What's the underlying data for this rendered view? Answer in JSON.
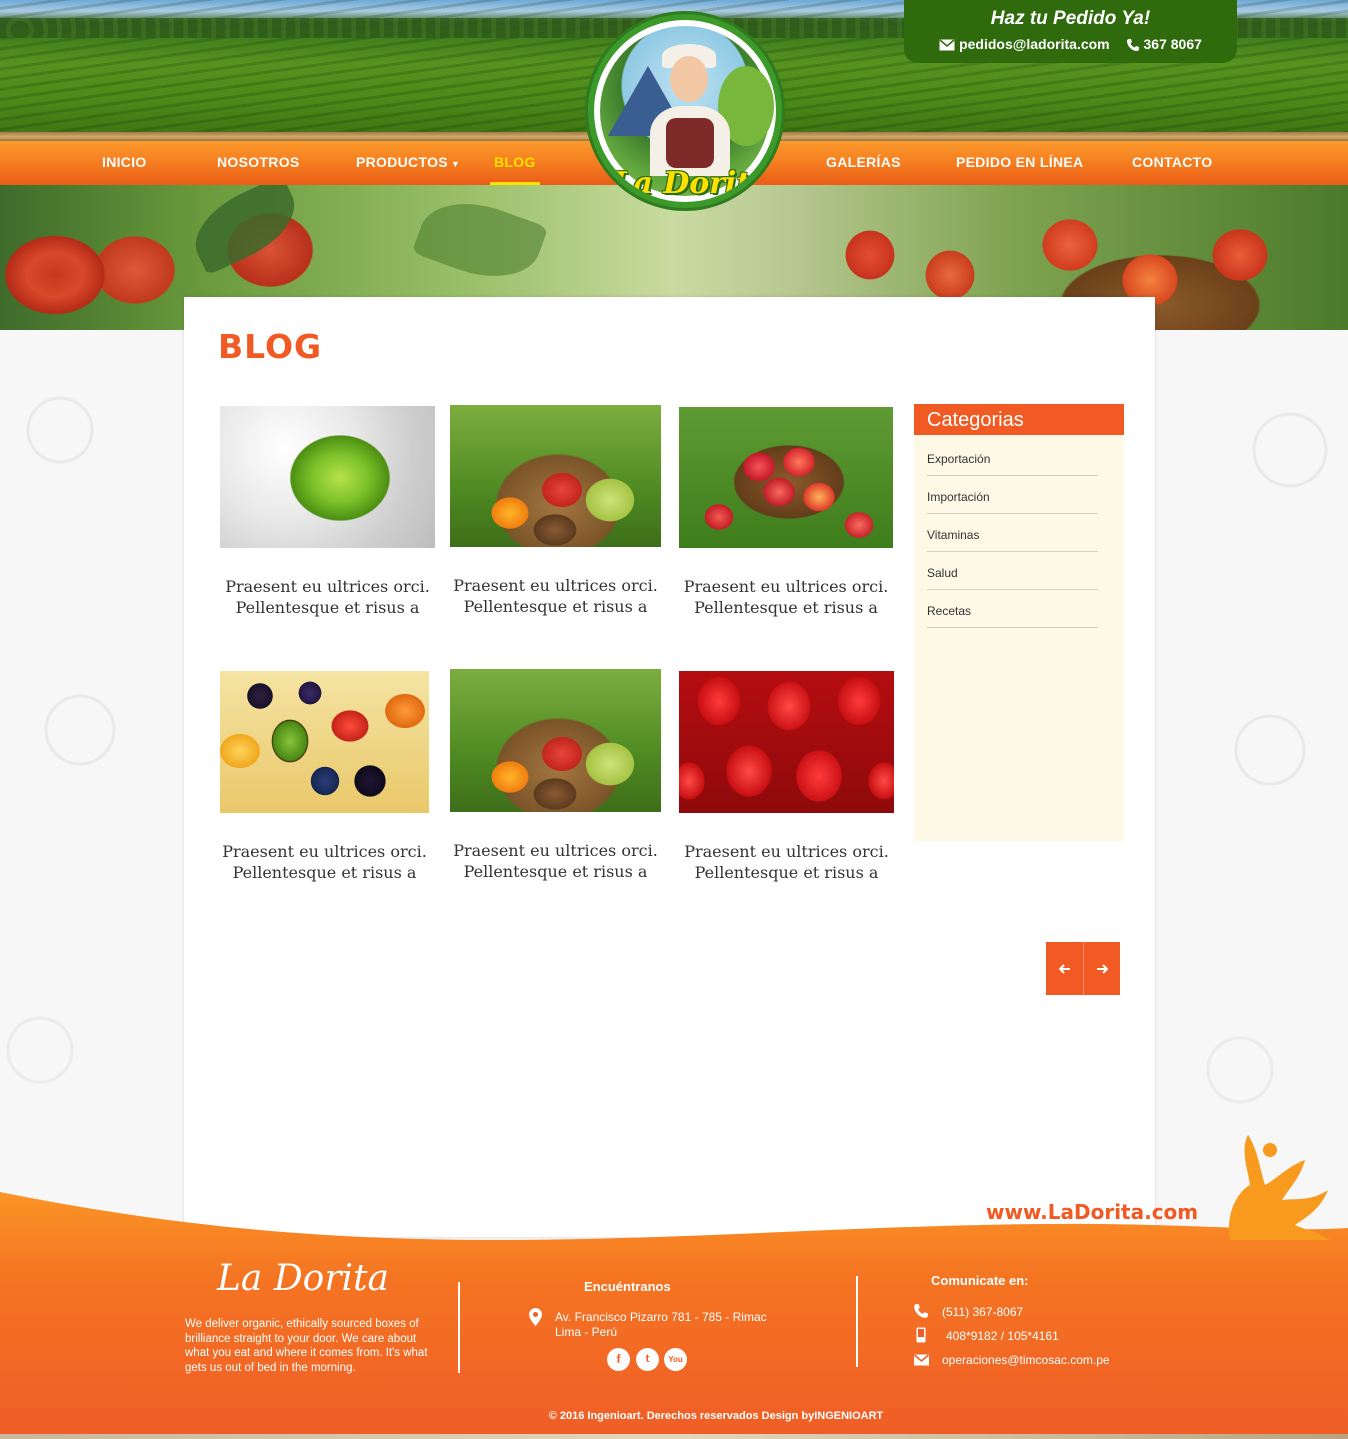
{
  "header": {
    "order_title": "Haz tu Pedido Ya!",
    "email": "pedidos@ladorita.com",
    "phone": "367 8067",
    "logo_text": "La Dorita"
  },
  "nav": {
    "items": [
      {
        "label": "INICIO"
      },
      {
        "label": "NOSOTROS"
      },
      {
        "label": "PRODUCTOS",
        "has_dropdown": true
      },
      {
        "label": "BLOG",
        "active": true
      },
      {
        "label": "GALERÍAS"
      },
      {
        "label": "PEDIDO EN LÍNEA"
      },
      {
        "label": "CONTACTO"
      }
    ]
  },
  "main": {
    "title": "BLOG",
    "posts": [
      {
        "title_line1": "Praesent eu ultrices orci.",
        "title_line2": "Pellentesque et risus a",
        "image": "lime-splash"
      },
      {
        "title_line1": "Praesent eu ultrices orci.",
        "title_line2": "Pellentesque et risus a",
        "image": "fruit-basket"
      },
      {
        "title_line1": "Praesent eu ultrices orci.",
        "title_line2": "Pellentesque et risus a",
        "image": "apple-basket"
      },
      {
        "title_line1": "Praesent eu ultrices orci.",
        "title_line2": "Pellentesque et risus a",
        "image": "fruit-salad"
      },
      {
        "title_line1": "Praesent eu ultrices orci.",
        "title_line2": "Pellentesque et risus a",
        "image": "fruit-basket"
      },
      {
        "title_line1": "Praesent eu ultrices orci.",
        "title_line2": "Pellentesque et risus a",
        "image": "strawberries"
      }
    ]
  },
  "sidebar": {
    "title": "Categorias",
    "categories": [
      "Exportación",
      "Importación",
      "Vitaminas",
      "Salud",
      "Recetas"
    ]
  },
  "pager": {
    "prev_icon": "arrow-left-icon",
    "next_icon": "arrow-right-icon"
  },
  "footer": {
    "url": "www.LaDorita.com",
    "brand": "La Dorita",
    "about": "We deliver organic, ethically sourced boxes of brilliance straight to your door. We care about what you eat and where it comes from. It's what gets us out of bed in the morning.",
    "find_us_title": "Encuéntranos",
    "address_line1": "Av. Francisco Pizarro 781 - 785 - Rimac",
    "address_line2": "Lima - Perú",
    "social": [
      "f",
      "t",
      "You"
    ],
    "contact_title": "Comunicate en:",
    "phone": "(511) 367-8067",
    "mobile": "408*9182 / 105*4161",
    "email": "operaciones@timcosac.com.pe",
    "copyright": "© 2016 Ingenioart. Derechos reservados Design byINGENIOART"
  },
  "colors": {
    "accent": "#f15a22",
    "nav_active": "#ffe100",
    "header_green": "#2f6a0c",
    "sidebar_bg": "#fef8e6"
  }
}
